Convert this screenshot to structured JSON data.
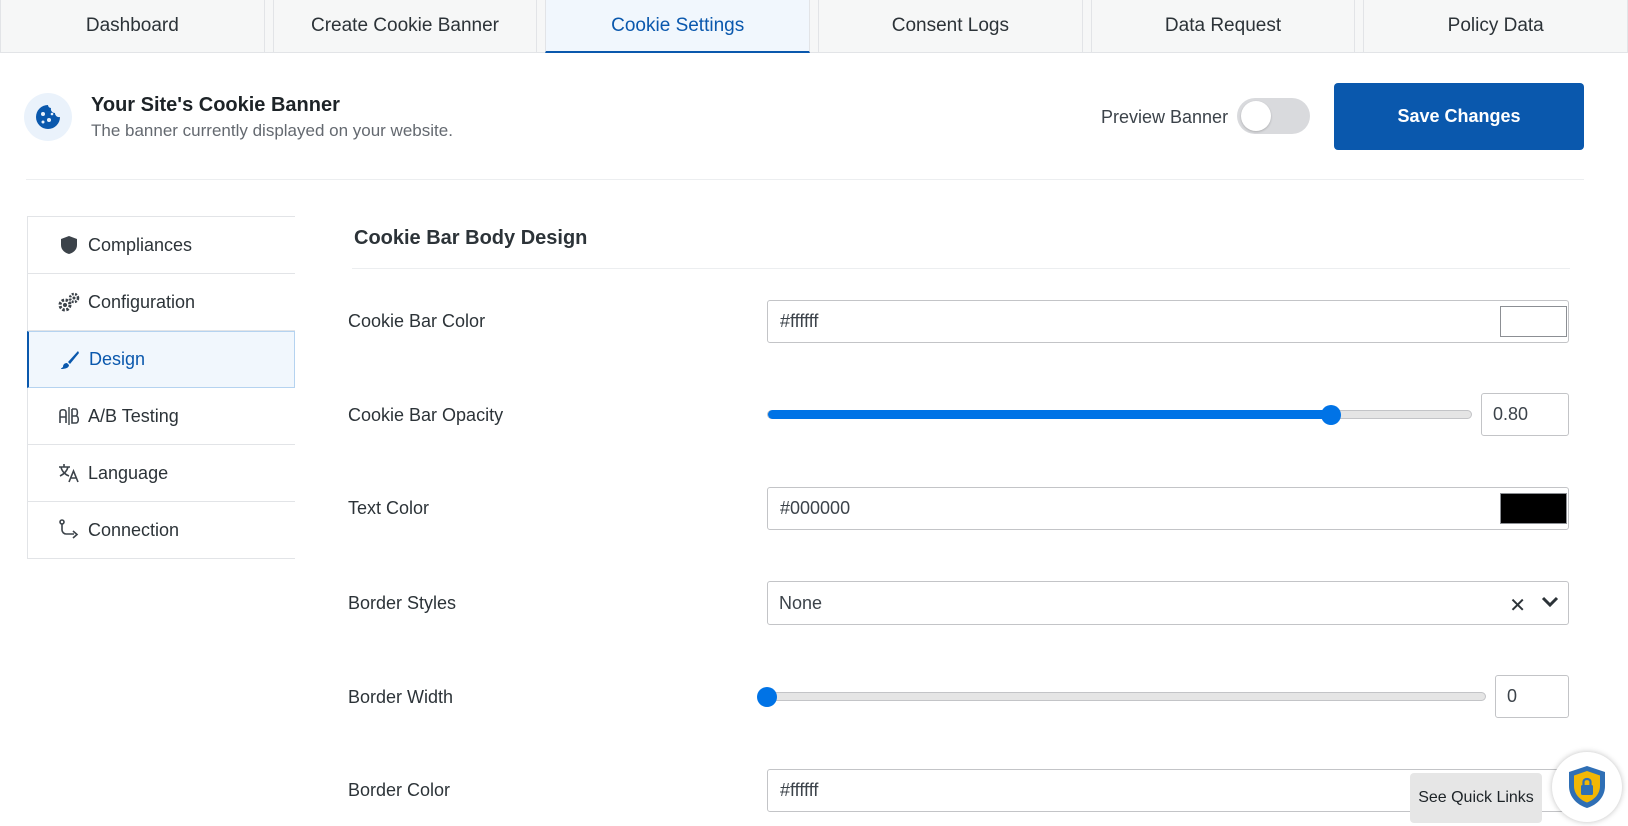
{
  "tabs": [
    {
      "label": "Dashboard"
    },
    {
      "label": "Create Cookie Banner"
    },
    {
      "label": "Cookie Settings"
    },
    {
      "label": "Consent Logs"
    },
    {
      "label": "Data Request"
    },
    {
      "label": "Policy Data"
    }
  ],
  "active_tab": "Cookie Settings",
  "header": {
    "icon": "cookie-icon",
    "title": "Your Site's Cookie Banner",
    "subtitle": "The banner currently displayed on your website.",
    "preview_label": "Preview Banner",
    "preview_enabled": false,
    "save_label": "Save Changes"
  },
  "sidebar": {
    "items": [
      {
        "label": "Compliances",
        "icon": "shield-icon"
      },
      {
        "label": "Configuration",
        "icon": "gears-icon"
      },
      {
        "label": "Design",
        "icon": "brush-icon"
      },
      {
        "label": "A/B Testing",
        "icon": "ab-testing-icon"
      },
      {
        "label": "Language",
        "icon": "translate-icon"
      },
      {
        "label": "Connection",
        "icon": "connection-icon"
      }
    ],
    "active": "Design"
  },
  "main": {
    "section_title": "Cookie Bar Body Design",
    "fields": {
      "bar_color": {
        "label": "Cookie Bar Color",
        "value": "#ffffff",
        "swatch": "#ffffff"
      },
      "bar_opacity": {
        "label": "Cookie Bar Opacity",
        "value": "0.80",
        "fraction": 0.8
      },
      "text_color": {
        "label": "Text Color",
        "value": "#000000",
        "swatch": "#000000"
      },
      "border_styles": {
        "label": "Border Styles",
        "value": "None"
      },
      "border_width": {
        "label": "Border Width",
        "value": "0",
        "fraction": 0
      },
      "border_color": {
        "label": "Border Color",
        "value": "#ffffff"
      }
    }
  },
  "quick_links": {
    "label": "See Quick Links"
  },
  "colors": {
    "accent": "#0a58ad",
    "slider": "#0073e6",
    "badge": "#f2b705"
  }
}
